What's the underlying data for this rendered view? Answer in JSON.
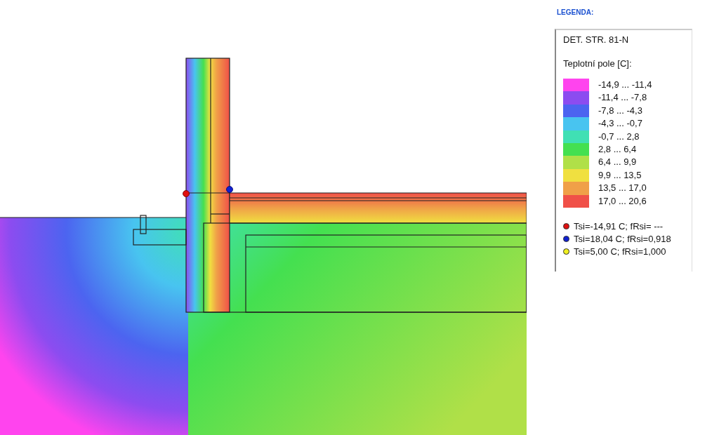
{
  "legend": {
    "heading": "LEGENDA:",
    "title": "DET. STR. 81-N",
    "scale_title": "Teplotní pole [C]:",
    "bands": [
      {
        "label": "-14,9 ... -11,4",
        "color": "#ff44ee"
      },
      {
        "label": "-11,4 ... -7,8",
        "color": "#8c4cf0"
      },
      {
        "label": "-7,8 ... -4,3",
        "color": "#4c64f0"
      },
      {
        "label": "-4,3 ... -0,7",
        "color": "#48c4f0"
      },
      {
        "label": "-0,7 ... 2,8",
        "color": "#40e0b4"
      },
      {
        "label": "2,8 ... 6,4",
        "color": "#44e050"
      },
      {
        "label": "6,4 ... 9,9",
        "color": "#b0e048"
      },
      {
        "label": "9,9 ... 13,5",
        "color": "#f0e040"
      },
      {
        "label": "13,5 ... 17,0",
        "color": "#f0a048"
      },
      {
        "label": "17,0 ... 20,6",
        "color": "#f05048"
      }
    ],
    "points": [
      {
        "label": "Tsi=-14,91 C; fRsi= ---",
        "color": "#e01010"
      },
      {
        "label": "Tsi=18,04 C; fRsi=0,918",
        "color": "#1020d0"
      },
      {
        "label": "Tsi=5,00 C; fRsi=1,000",
        "color": "#f0f020"
      }
    ]
  }
}
